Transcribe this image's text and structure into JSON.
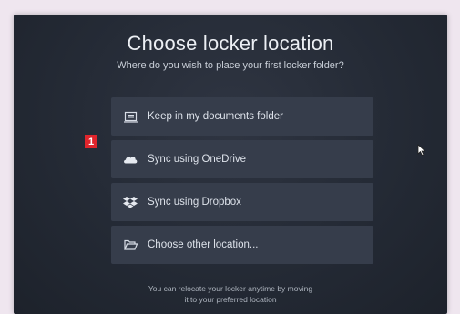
{
  "dialog": {
    "title": "Choose locker location",
    "subtitle": "Where do you wish to place your first locker folder?",
    "options": [
      {
        "label": "Keep in my documents folder",
        "icon": "documents-folder-icon"
      },
      {
        "label": "Sync using OneDrive",
        "icon": "onedrive-cloud-icon"
      },
      {
        "label": "Sync using Dropbox",
        "icon": "dropbox-icon"
      },
      {
        "label": "Choose other location...",
        "icon": "folder-open-icon"
      }
    ],
    "footer_line1": "You can relocate your locker anytime by moving",
    "footer_line2": "it to your preferred location"
  },
  "annotation": {
    "badge": "1",
    "color": "#e0252c"
  }
}
